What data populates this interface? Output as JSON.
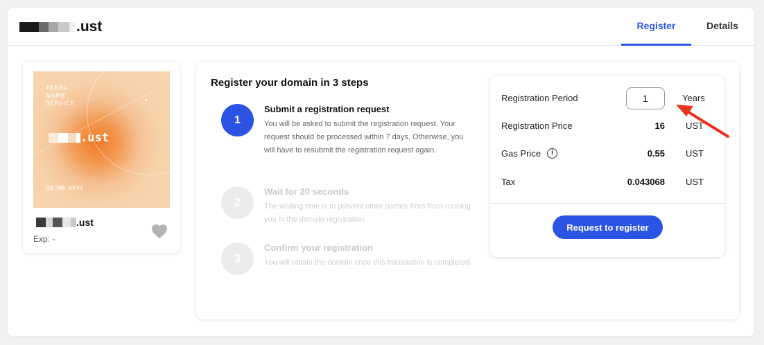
{
  "header": {
    "domain_suffix": ".ust",
    "tabs": [
      {
        "label": "Register",
        "active": true
      },
      {
        "label": "Details",
        "active": false
      }
    ],
    "accent_color": "#2c54e4"
  },
  "nft_card": {
    "brand_lines": [
      "TERRA",
      "NAME",
      "SERVICE"
    ],
    "image_domain_suffix": ".ust",
    "image_date": "DD.MM.YYYY",
    "name_suffix": ".ust",
    "expiry": "Exp: -",
    "favorite_icon": "heart-icon"
  },
  "steps": {
    "title": "Register your domain in 3 steps",
    "items": [
      {
        "number": "1",
        "title": "Submit a registration request",
        "description": "You will be asked to submit the registration request. Your request should be processed within 7 days. Otherwise, you will have to resubmit the registration request again.",
        "active": true
      },
      {
        "number": "2",
        "title": "Wait for 20 seconds",
        "description": "The waiting time is to prevent other parties from front-running you in the domain registration.",
        "active": false
      },
      {
        "number": "3",
        "title": "Confirm your registration",
        "description": "You will obtain the domain once this transaction is completed.",
        "active": false
      }
    ]
  },
  "registration": {
    "period_label": "Registration Period",
    "period_value": "1",
    "period_unit": "Years",
    "price_label": "Registration Price",
    "price_value": "16",
    "price_unit": "UST",
    "gas_label": "Gas Price",
    "gas_value": "0.55",
    "gas_unit": "UST",
    "tax_label": "Tax",
    "tax_value": "0.043068",
    "tax_unit": "UST",
    "request_button": "Request to register"
  }
}
